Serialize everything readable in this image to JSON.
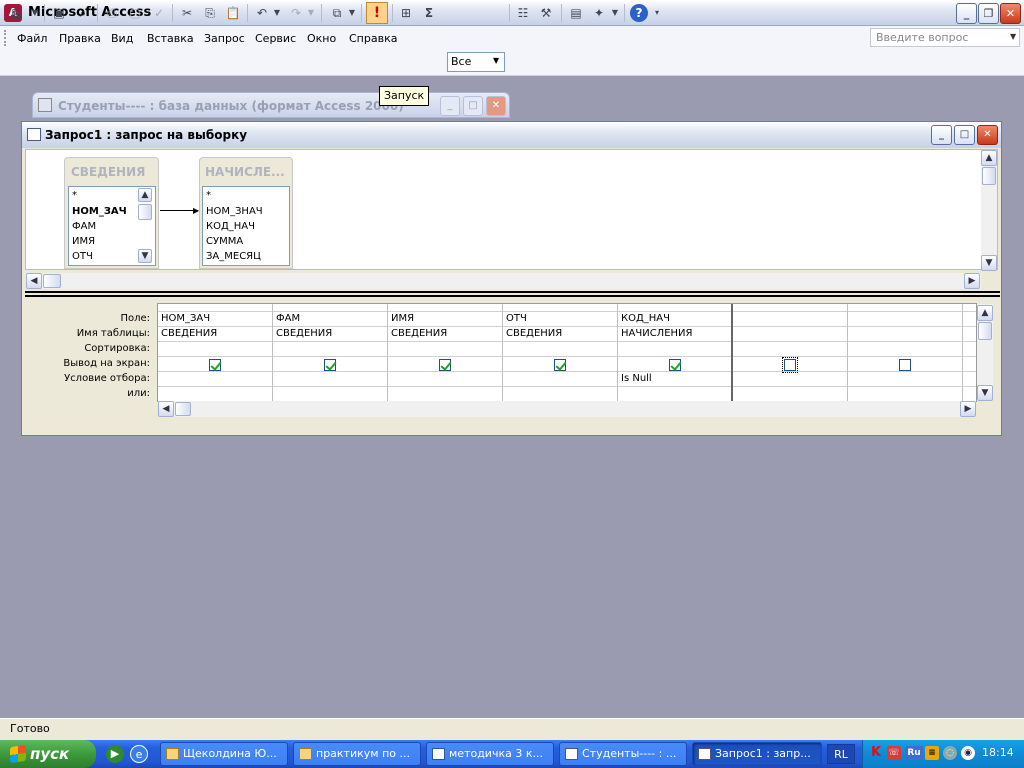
{
  "app": {
    "title": "Microsoft Access",
    "icon": "access-icon"
  },
  "menu": [
    "Файл",
    "Правка",
    "Вид",
    "Вставка",
    "Запрос",
    "Сервис",
    "Окно",
    "Справка"
  ],
  "help_box": {
    "placeholder": "Введите вопрос"
  },
  "toolbar": {
    "top_values": "Все",
    "tooltip": "Запуск",
    "run_glyph": "!",
    "sum_glyph": "Σ"
  },
  "db_window": {
    "title": "Студенты---- : база данных (формат Access 2000)"
  },
  "query_window": {
    "title": "Запрос1 : запрос на выборку",
    "tables": [
      {
        "name": "СВЕДЕНИЯ",
        "fields": [
          "*",
          "НОМ_ЗАЧ",
          "ФАМ",
          "ИМЯ",
          "ОТЧ"
        ],
        "key_field": "НОМ_ЗАЧ"
      },
      {
        "name": "НАЧИСЛЕ...",
        "fields": [
          "*",
          "НОМ_ЗНАЧ",
          "КОД_НАЧ",
          "СУММА",
          "ЗА_МЕСЯЦ"
        ]
      }
    ],
    "row_labels": [
      "Поле:",
      "Имя таблицы:",
      "Сортировка:",
      "Вывод на экран:",
      "Условие отбора:",
      "или:"
    ],
    "columns": [
      {
        "field": "НОМ_ЗАЧ",
        "table": "СВЕДЕНИЯ",
        "sort": "",
        "show": true,
        "criteria": "",
        "or": ""
      },
      {
        "field": "ФАМ",
        "table": "СВЕДЕНИЯ",
        "sort": "",
        "show": true,
        "criteria": "",
        "or": ""
      },
      {
        "field": "ИМЯ",
        "table": "СВЕДЕНИЯ",
        "sort": "",
        "show": true,
        "criteria": "",
        "or": ""
      },
      {
        "field": "ОТЧ",
        "table": "СВЕДЕНИЯ",
        "sort": "",
        "show": true,
        "criteria": "",
        "or": ""
      },
      {
        "field": "КОД_НАЧ",
        "table": "НАЧИСЛЕНИЯ",
        "sort": "",
        "show": true,
        "criteria": "Is Null",
        "or": ""
      },
      {
        "field": "",
        "table": "",
        "sort": "",
        "show": false,
        "criteria": "",
        "or": ""
      },
      {
        "field": "",
        "table": "",
        "sort": "",
        "show": false,
        "criteria": "",
        "or": ""
      }
    ]
  },
  "status": {
    "text": "Готово"
  },
  "taskbar": {
    "start_label": "пуск",
    "tasks": [
      {
        "label": "Щеколдина Ю...",
        "icon": "folder-icon"
      },
      {
        "label": "практикум по ...",
        "icon": "folder-icon"
      },
      {
        "label": "методичка 3 к...",
        "icon": "word-icon"
      },
      {
        "label": "Студенты---- : ...",
        "icon": "access-window-icon"
      },
      {
        "label": "Запрос1 : запр...",
        "icon": "query-icon",
        "active": true
      }
    ],
    "lang": "RL",
    "tray_lang": "Ru",
    "clock": "18:14"
  },
  "colors": {
    "desktop": "#9a9ab0",
    "taskbar": "#245edb",
    "start": "#3c9a3c",
    "checkbox_check": "#21a121"
  }
}
